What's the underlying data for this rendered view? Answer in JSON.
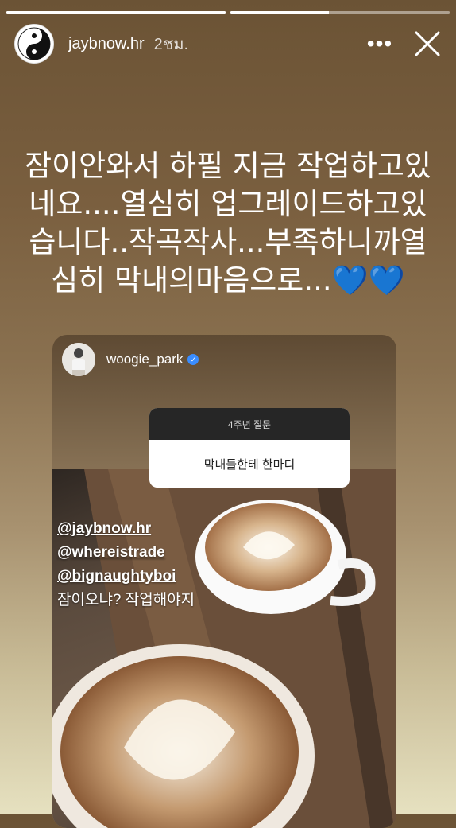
{
  "story": {
    "progress": [
      1.0,
      0.45
    ],
    "user": {
      "name": "jaybnow.hr",
      "time": "2ชม."
    },
    "more_label": "•••",
    "caption": "잠이안와서 하필 지금 작업하고있네요....열심히 업그레이드하고있습니다..작곡작사...부족하니까열심히 막내의마음으로...",
    "hearts": "💙💙"
  },
  "shared_post": {
    "user": "woogie_park",
    "verified": true,
    "question_box": {
      "title": "4주년 질문",
      "text": "막내들한테 한마디"
    },
    "mentions": [
      "@jaybnow.hr",
      "@whereistrade",
      "@bignaughtyboi"
    ],
    "reply": "잠이오냐? 작업해야지"
  },
  "colors": {
    "verified": "#3a8dff",
    "heart": "#2f7dff",
    "question_header": "#262626"
  }
}
